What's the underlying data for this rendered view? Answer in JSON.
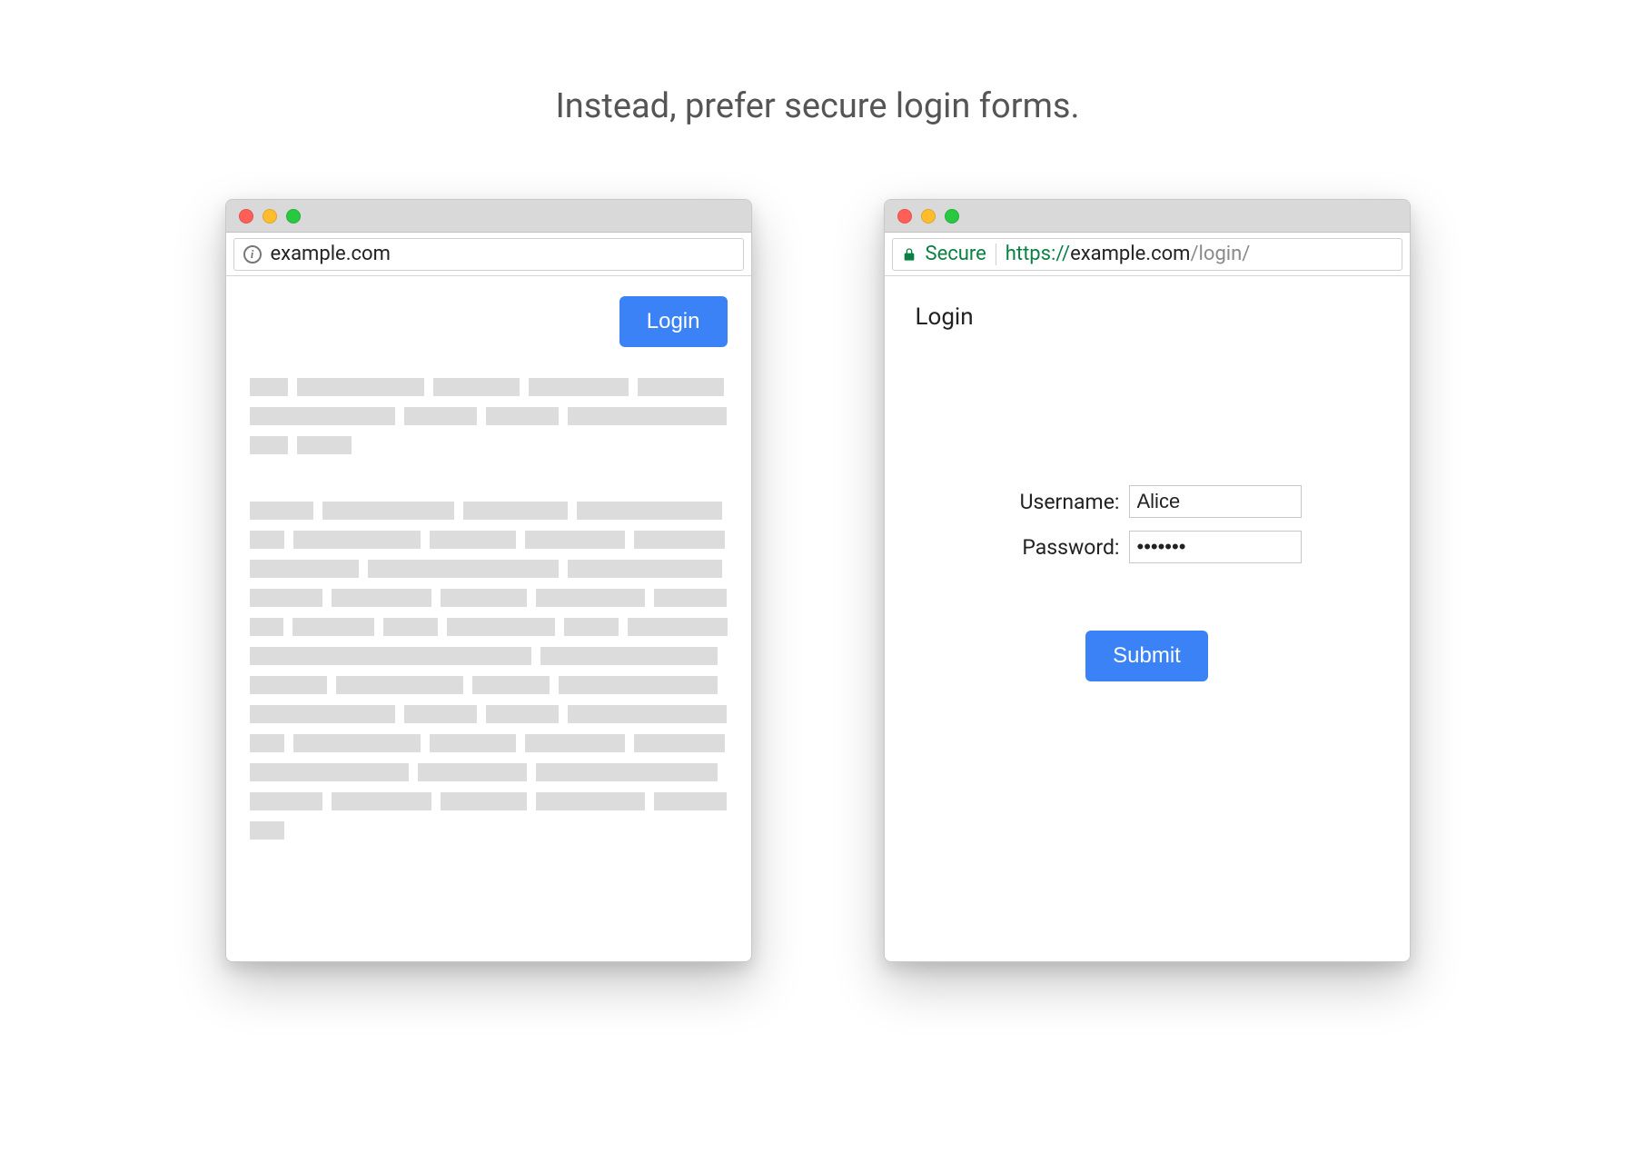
{
  "page": {
    "title": "Instead, prefer secure login forms."
  },
  "left_window": {
    "url_text": "example.com",
    "login_button": "Login"
  },
  "right_window": {
    "secure_label": "Secure",
    "url_scheme": "https://",
    "url_host": "example.com",
    "url_path": "/login/",
    "page_heading": "Login",
    "form": {
      "username_label": "Username:",
      "username_value": "Alice",
      "password_label": "Password:",
      "password_value": "•••••••",
      "submit_label": "Submit"
    }
  },
  "colors": {
    "primary_button": "#3b82f6",
    "secure_green": "#0b8043",
    "placeholder_grey": "#dcdcdc"
  }
}
